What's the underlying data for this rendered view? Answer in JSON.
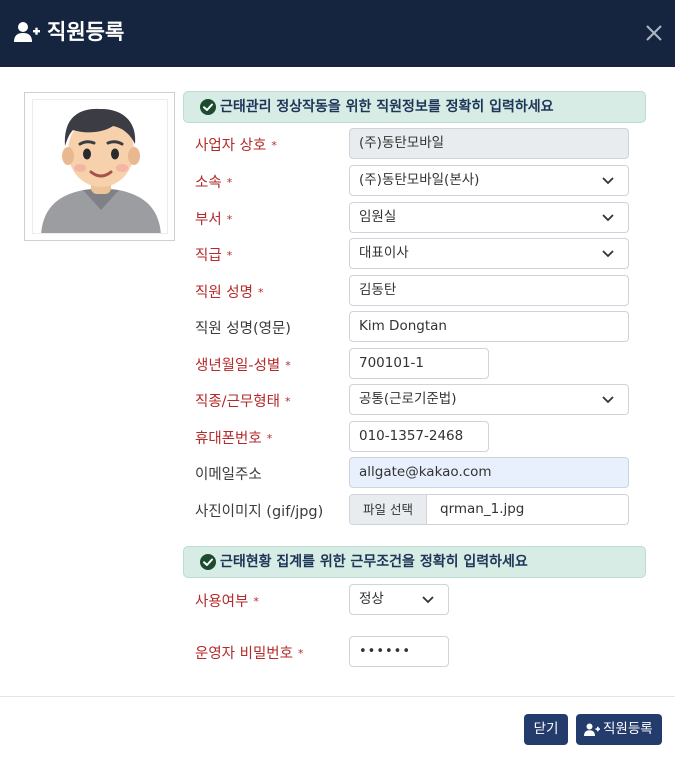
{
  "header": {
    "title": "직원등록",
    "icon": "user-plus-icon"
  },
  "sections": {
    "employee_notice": "근태관리 정상작동을 위한 직원정보를 정확히 입력하세요",
    "work_notice": "근태현황 집계를 위한 근무조건을 정확히 입력하세요"
  },
  "form": {
    "company": {
      "label": "사업자 상호",
      "value": "(주)동탄모바일"
    },
    "affiliation": {
      "label": "소속",
      "value": "(주)동탄모바일(본사)"
    },
    "department": {
      "label": "부서",
      "value": "임원실"
    },
    "position": {
      "label": "직급",
      "value": "대표이사"
    },
    "name": {
      "label": "직원 성명",
      "value": "김동탄"
    },
    "name_en": {
      "label": "직원 성명(영문)",
      "value": "Kim Dongtan"
    },
    "birth": {
      "label": "생년월일-성별",
      "value": "700101-1"
    },
    "job_type": {
      "label": "직종/근무형태",
      "value": "공통(근로기준법)"
    },
    "mobile": {
      "label": "휴대폰번호",
      "value": "010-1357-2468"
    },
    "email": {
      "label": "이메일주소",
      "value": "allgate@kakao.com"
    },
    "photo": {
      "label": "사진이미지 (gif/jpg)",
      "button": "파일 선택",
      "filename": "qrman_1.jpg"
    },
    "usage": {
      "label": "사용여부",
      "value": "정상"
    },
    "operator_pw": {
      "label": "운영자 비밀번호",
      "value": "••••••"
    }
  },
  "required_mark": "*",
  "buttons": {
    "close": "닫기",
    "register": "직원등록"
  },
  "colors": {
    "header_bg": "#16253f",
    "required": "#b52a2a",
    "button": "#243c6c",
    "banner_bg": "#d6ece4"
  }
}
